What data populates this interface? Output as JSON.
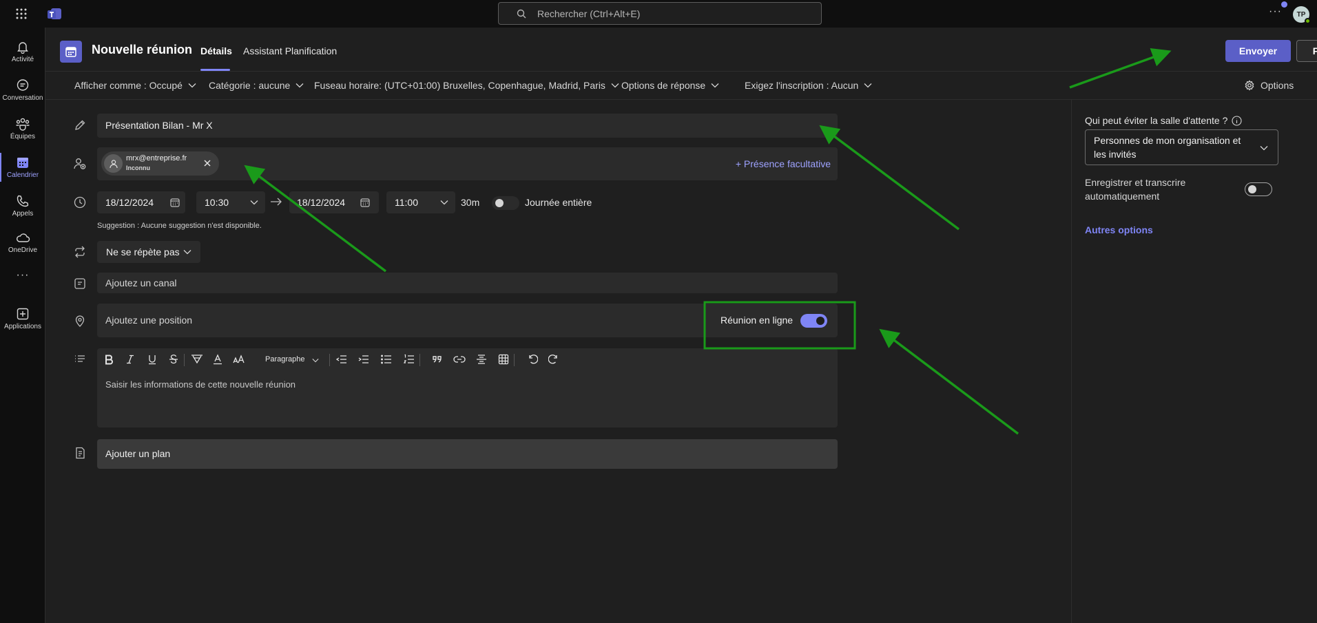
{
  "topbar": {
    "search_placeholder": "Rechercher (Ctrl+Alt+E)",
    "more": "···",
    "avatar_initials": "TP"
  },
  "rail": {
    "items": [
      {
        "label": "Activité",
        "icon": "bell-icon"
      },
      {
        "label": "Conversation",
        "icon": "chat-icon"
      },
      {
        "label": "Équipes",
        "icon": "teams-icon"
      },
      {
        "label": "Calendrier",
        "icon": "calendar-icon",
        "active": true
      },
      {
        "label": "Appels",
        "icon": "phone-icon"
      },
      {
        "label": "OneDrive",
        "icon": "cloud-icon"
      },
      {
        "label": "···",
        "icon": "more-icon"
      },
      {
        "label": "Applications",
        "icon": "add-app-icon"
      }
    ]
  },
  "header": {
    "title": "Nouvelle réunion",
    "tabs": [
      {
        "label": "Détails",
        "active": true
      },
      {
        "label": "Assistant Planification",
        "active": false
      }
    ],
    "send_label": "Envoyer",
    "close_label": "Fermer"
  },
  "options_bar": {
    "show_as": "Afficher comme : Occupé",
    "category": "Catégorie : aucune",
    "timezone": "Fuseau horaire: (UTC+01:00) Bruxelles, Copenhague, Madrid, Paris",
    "response": "Options de réponse",
    "registration": "Exigez l'inscription : Aucun",
    "options": "Options"
  },
  "form": {
    "title": "Présentation Bilan - Mr X",
    "attendee": {
      "email": "mrx@entreprise.fr",
      "status": "Inconnu"
    },
    "optional_link": "+ Présence facultative",
    "start_date": "18/12/2024",
    "start_time": "10:30",
    "end_date": "18/12/2024",
    "end_time": "11:00",
    "duration": "30m",
    "all_day_label": "Journée entière",
    "all_day": false,
    "suggestion": "Suggestion : Aucune suggestion n'est disponible.",
    "repeat": "Ne se répète pas",
    "channel_placeholder": "Ajoutez un canal",
    "location_placeholder": "Ajoutez une position",
    "online_meeting_label": "Réunion en ligne",
    "online_meeting": true,
    "paragraph_style": "Paragraphe",
    "details_placeholder": "Saisir les informations de cette nouvelle réunion",
    "agenda_label": "Ajouter un plan"
  },
  "right_panel": {
    "lobby_label": "Qui peut éviter la salle d'attente ?",
    "lobby_value_line1": "Personnes de mon organisation et",
    "lobby_value_line2": "les invités",
    "record_label_line1": "Enregistrer et transcrire",
    "record_label_line2": "automatiquement",
    "record": false,
    "more_options": "Autres options"
  },
  "colors": {
    "accent": "#5b5fc7",
    "accent_light": "#7f85f5",
    "annotation": "#1a9a1a"
  }
}
